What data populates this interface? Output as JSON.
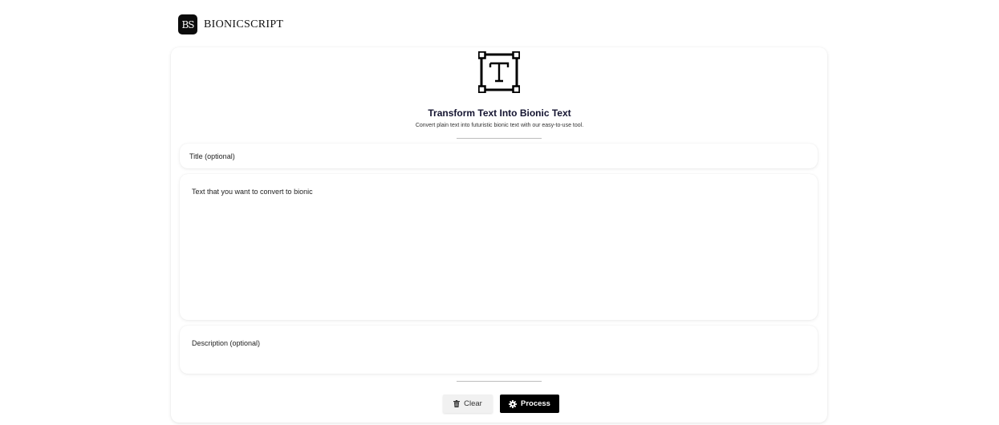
{
  "brand": {
    "logo_text": "BS",
    "name": "BIONICSCRIPT"
  },
  "hero": {
    "icon": "text-frame-icon",
    "title": "Transform Text Into Bionic Text",
    "subtitle": "Convert plain text into futuristic bionic text with our easy-to-use tool."
  },
  "form": {
    "title_placeholder": "Title (optional)",
    "text_placeholder": "Text that you want to convert to bionic",
    "description_placeholder": "Description (optional)"
  },
  "actions": {
    "clear_label": "Clear",
    "clear_icon": "trash-icon",
    "process_label": "Process",
    "process_icon": "gear-icon"
  },
  "colors": {
    "primary": "#000000",
    "secondary_button_bg": "#f1f1f1",
    "title_color": "#141430"
  }
}
